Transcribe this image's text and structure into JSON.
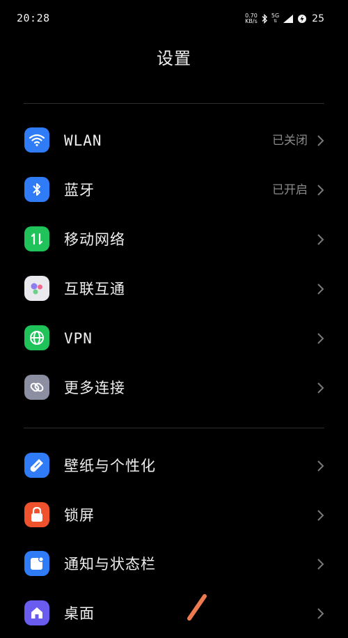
{
  "status_bar": {
    "time": "20:28",
    "net_speed_value": "0.70",
    "net_speed_unit": "KB/s",
    "network_type": "5G",
    "battery_level": "25"
  },
  "page": {
    "title": "设置"
  },
  "sections": [
    {
      "items": [
        {
          "label": "WLAN",
          "value": "已关闭",
          "icon": "wifi-icon",
          "color": "#2f7cf6"
        },
        {
          "label": "蓝牙",
          "value": "已开启",
          "icon": "bluetooth-icon",
          "color": "#2f7cf6"
        },
        {
          "label": "移动网络",
          "value": "",
          "icon": "mobile-data-icon",
          "color": "#1fc35a"
        },
        {
          "label": "互联互通",
          "value": "",
          "icon": "interconnect-icon",
          "color": "#e9e9ee"
        },
        {
          "label": "VPN",
          "value": "",
          "icon": "globe-icon",
          "color": "#1fc35a"
        },
        {
          "label": "更多连接",
          "value": "",
          "icon": "link-icon",
          "color": "#8c8fa1"
        }
      ]
    },
    {
      "items": [
        {
          "label": "壁纸与个性化",
          "value": "",
          "icon": "brush-icon",
          "color": "#2f7cf6"
        },
        {
          "label": "锁屏",
          "value": "",
          "icon": "lock-icon",
          "color": "#f0522d"
        },
        {
          "label": "通知与状态栏",
          "value": "",
          "icon": "notification-icon",
          "color": "#2f7cf6"
        },
        {
          "label": "桌面",
          "value": "",
          "icon": "home-icon",
          "color": "#6b5cf0"
        }
      ]
    }
  ]
}
